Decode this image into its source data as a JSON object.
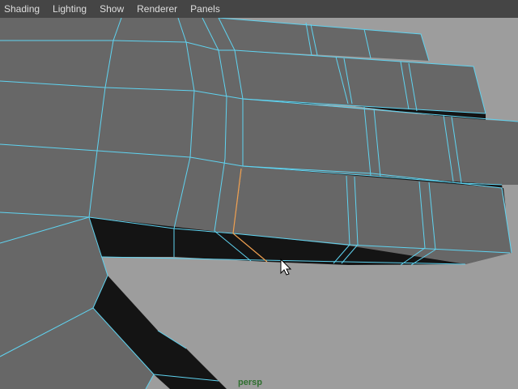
{
  "menubar": {
    "items": [
      {
        "key": "shading",
        "label": "Shading"
      },
      {
        "key": "lighting",
        "label": "Lighting"
      },
      {
        "key": "show",
        "label": "Show"
      },
      {
        "key": "renderer",
        "label": "Renderer"
      },
      {
        "key": "panels",
        "label": "Panels"
      }
    ]
  },
  "viewport": {
    "camera_label": "persp",
    "background_color": "#9d9d9d",
    "mesh_face_color": "#676767",
    "mesh_shadow_color": "#141414",
    "wireframe_color": "#5fd3f0",
    "selected_edge_color": "#f0a050"
  }
}
